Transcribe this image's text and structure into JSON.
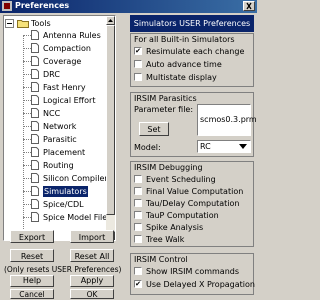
{
  "window": {
    "title": "Preferences"
  },
  "tree": {
    "root": "Tools",
    "items": [
      "Antenna Rules",
      "Compaction",
      "Coverage",
      "DRC",
      "Fast Henry",
      "Logical Effort",
      "NCC",
      "Network",
      "Parasitic",
      "Placement",
      "Routing",
      "Silicon Compiler",
      "Simulators",
      "Spice/CDL",
      "Spice Model Files"
    ],
    "selected": "Simulators"
  },
  "buttons": {
    "export": "Export",
    "import": "Import",
    "reset": "Reset",
    "reset_all": "Reset All",
    "help": "Help",
    "apply": "Apply",
    "cancel": "Cancel",
    "ok": "OK"
  },
  "note": "(Only resets USER Preferences)",
  "panel_header": "Simulators USER Preferences",
  "built_in": {
    "title": "For all Built-in Simulators",
    "resimulate": "Resimulate each change",
    "auto_advance": "Auto advance time",
    "multistate": "Multistate display"
  },
  "parasitics": {
    "title": "IRSIM Parasitics",
    "param_label": "Parameter file:",
    "param_value": "scmos0.3.prm",
    "set": "Set",
    "model_label": "Model:",
    "model_value": "RC"
  },
  "debugging": {
    "title": "IRSIM Debugging",
    "items": [
      "Event Scheduling",
      "Final Value Computation",
      "Tau/Delay Computation",
      "TauP Computation",
      "Spike Analysis",
      "Tree Walk"
    ]
  },
  "control": {
    "title": "IRSIM Control",
    "show_cmds": "Show IRSIM commands",
    "delayed_x": "Use Delayed X Propagation"
  }
}
